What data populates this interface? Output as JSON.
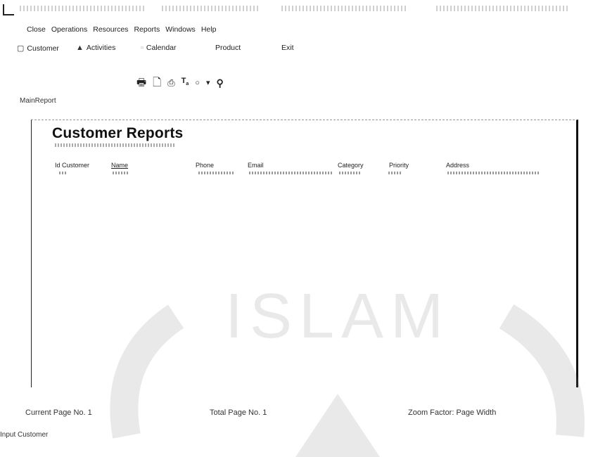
{
  "menubar": {
    "items": [
      "Close",
      "Operations",
      "Resources",
      "Reports",
      "Windows",
      "Help"
    ]
  },
  "navbar": {
    "items": [
      {
        "label": "Customer",
        "icon": "customer-icon"
      },
      {
        "label": "Activities",
        "icon": "activities-icon"
      },
      {
        "label": "Calendar",
        "icon": "calendar-icon"
      },
      {
        "label": "Product",
        "icon": ""
      },
      {
        "label": "Exit",
        "icon": ""
      }
    ]
  },
  "report_toolbar": {
    "tools": [
      "print-icon",
      "page-icon",
      "export-icon",
      "text-icon",
      "zoom-icon",
      "dropdown-icon",
      "find-icon"
    ]
  },
  "main_report_label": "MainReport",
  "report": {
    "title": "Customer Reports",
    "columns": [
      "Id Customer",
      "Name",
      "Phone",
      "Email",
      "Category",
      "Priority",
      "Address"
    ]
  },
  "status": {
    "current_page": "Current Page No. 1",
    "total_page": "Total Page No. 1",
    "zoom": "Zoom Factor: Page Width"
  },
  "bottom_label": "Input Customer",
  "watermark": {
    "text": "ISLAM"
  },
  "colors": {
    "text": "#1a1a1a",
    "frame": "#111111",
    "watermark": "#9a9a9a"
  }
}
